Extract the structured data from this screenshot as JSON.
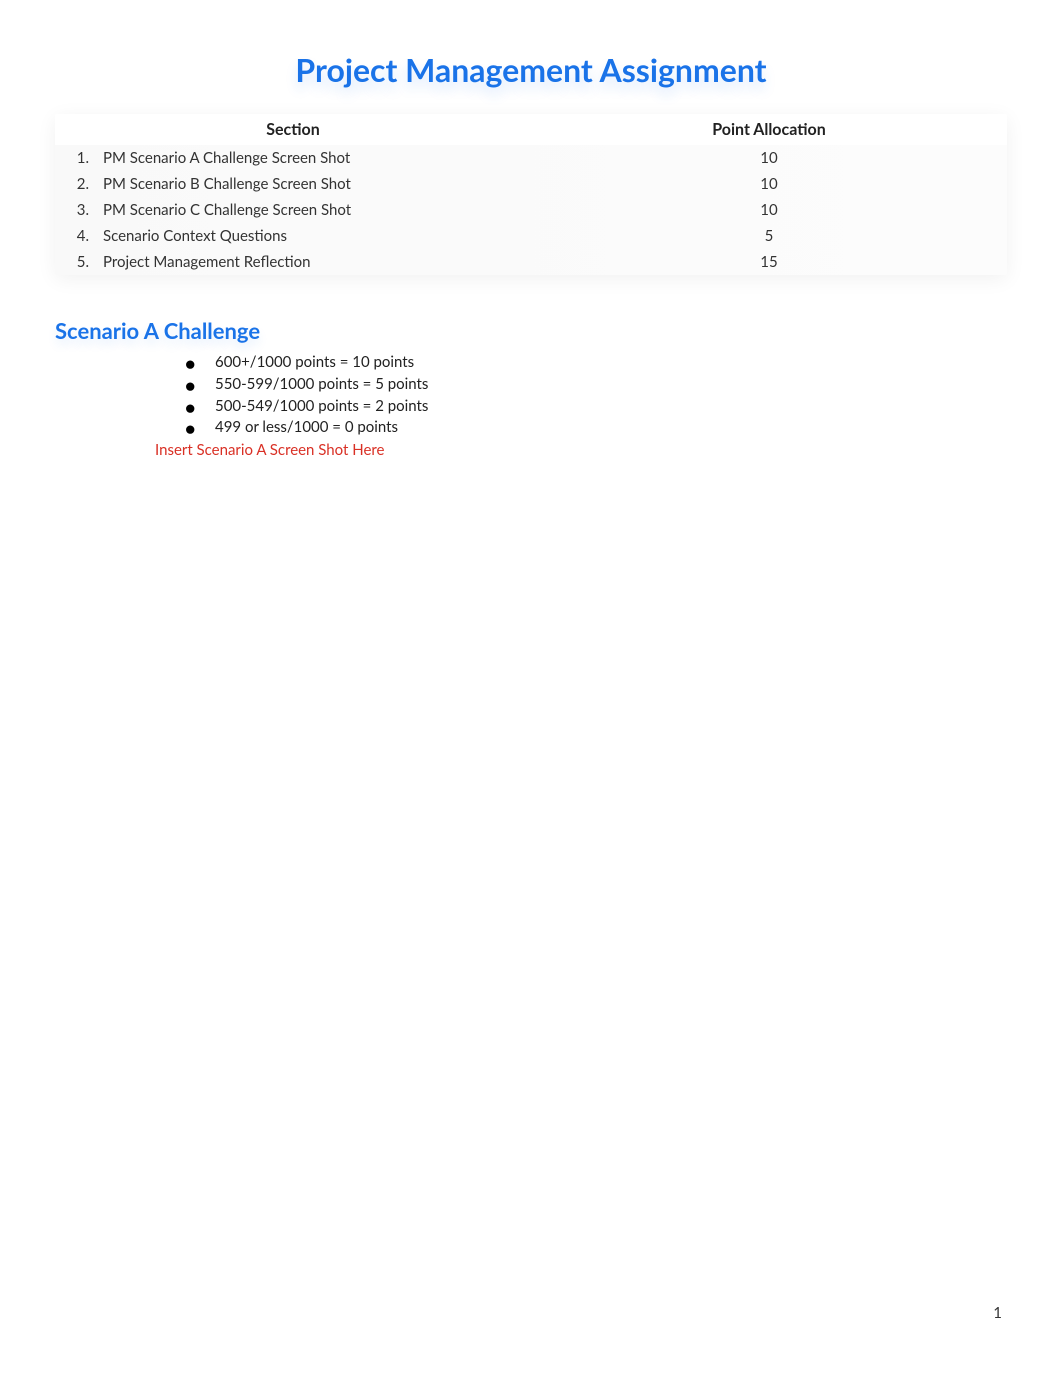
{
  "title": "Project Management Assignment",
  "table": {
    "headers": {
      "section": "Section",
      "points": "Point Allocation"
    },
    "rows": [
      {
        "num": "1.",
        "label": "PM Scenario A Challenge Screen Shot",
        "points": "10"
      },
      {
        "num": "2.",
        "label": "PM Scenario B Challenge Screen Shot",
        "points": "10"
      },
      {
        "num": "3.",
        "label": "PM Scenario C Challenge Screen Shot",
        "points": "10"
      },
      {
        "num": "4.",
        "label": "Scenario Context Questions",
        "points": "5"
      },
      {
        "num": "5.",
        "label": "Project Management Reflection",
        "points": "15"
      }
    ]
  },
  "scenarioA": {
    "heading": "Scenario A Challenge",
    "bullets": [
      "600+/1000 points = 10 points",
      "550-599/1000 points = 5 points",
      "500-549/1000 points = 2 points",
      "499 or less/1000 = 0 points"
    ],
    "insert_text": "Insert Scenario A Screen Shot Here"
  },
  "page_number": "1"
}
